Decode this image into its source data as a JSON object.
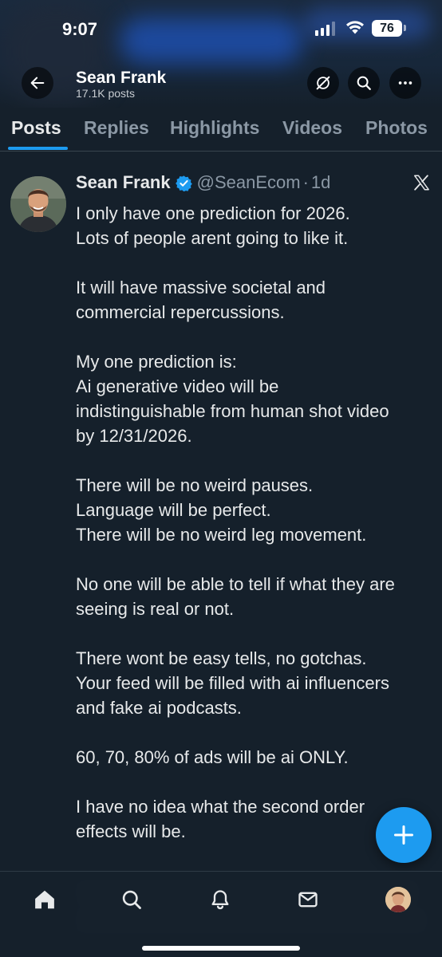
{
  "status_bar": {
    "time": "9:07",
    "battery": "76"
  },
  "header": {
    "name": "Sean Frank",
    "posts_count": "17.1K posts"
  },
  "tabs": [
    {
      "label": "Posts",
      "active": true
    },
    {
      "label": "Replies",
      "active": false
    },
    {
      "label": "Highlights",
      "active": false
    },
    {
      "label": "Videos",
      "active": false
    },
    {
      "label": "Photos",
      "active": false
    }
  ],
  "tweet": {
    "author_name": "Sean Frank",
    "handle": "@SeanEcom",
    "separator": "·",
    "time": "1d",
    "paragraphs": [
      [
        "I only have one prediction for 2026.",
        "Lots of people arent going to like it."
      ],
      [
        "It will have massive societal and",
        "commercial repercussions."
      ],
      [
        "My one prediction is:",
        "Ai generative video will be",
        "indistinguishable from human shot video",
        "by 12/31/2026."
      ],
      [
        "There will be no weird pauses.",
        "Language will be perfect.",
        "There will be no weird leg movement."
      ],
      [
        "No one will be able to tell if what they are",
        "seeing is real or not."
      ],
      [
        "There wont be easy tells, no gotchas.",
        "Your feed will be filled with ai influencers",
        "and fake ai podcasts."
      ],
      [
        "60, 70, 80% of ads will be ai ONLY."
      ],
      [
        "I have no idea what the second order",
        "effects will be."
      ]
    ]
  },
  "icons": {
    "back": "arrow-left-icon",
    "grok": "grok-icon",
    "search": "search-icon",
    "more": "more-horizontal-icon",
    "verified": "verified-badge-icon",
    "platform": "x-logo-icon",
    "compose": "plus-icon",
    "nav": [
      "home-icon",
      "search-icon",
      "notifications-bell-icon",
      "messages-envelope-icon",
      "profile-avatar"
    ]
  },
  "colors": {
    "background": "#15202b",
    "accent": "#1d9bf0",
    "text_primary": "#e7e9ea",
    "text_secondary": "#8b98a5"
  }
}
